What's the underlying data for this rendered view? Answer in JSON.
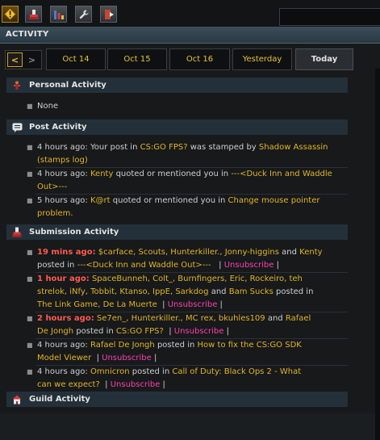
{
  "toolbar": {
    "icons": [
      "alert-icon",
      "stamp-icon",
      "chart-icon",
      "wrench-icon",
      "exit-icon"
    ]
  },
  "header": {
    "title": "ACTIVITY"
  },
  "nav": {
    "prev": "<",
    "next": ">",
    "days": [
      "Oct 14",
      "Oct 15",
      "Oct 16",
      "Yesterday",
      "Today"
    ],
    "selected": "Today"
  },
  "sections": {
    "personal": {
      "title": "Personal Activity",
      "none": "None"
    },
    "posts": {
      "title": "Post Activity",
      "items": [
        {
          "time": "4 hours ago:",
          "t1": "Your post in",
          "link1": "CS:GO FPS?",
          "t2": "was stamped by",
          "link2": "Shadow Assassin (stamps log)"
        },
        {
          "time": "4 hours ago:",
          "user": "Kenty",
          "t1": "quoted or mentioned you in",
          "link1": "---<Duck Inn and Waddle Out>---"
        },
        {
          "time": "5 hours ago:",
          "user": "K@rt",
          "t1": "quoted or mentioned you in",
          "link1": "Change mouse pointer problem."
        }
      ]
    },
    "submission": {
      "title": "Submission Activity",
      "unsubscribe": "Unsubscribe",
      "items": [
        {
          "time": "19 mins ago:",
          "users": "$carface, Scouts, Hunterkiller., Jonny-higgins",
          "and": "and",
          "user2": "Kenty",
          "t1": "posted in",
          "link": "---<Duck Inn and Waddle Out>---"
        },
        {
          "time": "1 hour ago:",
          "users_l1": "SpaceBunneh, Colt_, Burnfingers, Eric, Rockeiro, teh",
          "users_l2": "strelok, iNfy, Tobbit, Ktanso, IppE, Sarkdog",
          "and": "and",
          "user2": "Bam Sucks",
          "t1": "posted in",
          "link": "The Link Game, De La Muerte"
        },
        {
          "time": "2 hours ago:",
          "users": "Se7en_, Hunterkiller., MC rex, bkuhles109",
          "and": "and",
          "user2_l1": "Rafael",
          "user2_l2": "De Jongh",
          "t1": "posted in",
          "link": "CS:GO FPS?"
        },
        {
          "time": "4 hours ago:",
          "user": "Rafael De Jongh",
          "t1": "posted in",
          "link_l1": "How to fix the CS:GO SDK",
          "link_l2": "Model Viewer"
        },
        {
          "time": "4 hours ago:",
          "user": "Omnicron",
          "t1": "posted in",
          "link_l1": "Call of Duty: Black Ops 2 - What",
          "link_l2": "can we expect?"
        }
      ]
    },
    "guild": {
      "title": "Guild Activity"
    }
  },
  "colors": {
    "link": "#e3b523",
    "recent": "#ff5a4e",
    "unsubscribe": "#ff3fb0",
    "header": "#3c4e5a"
  }
}
